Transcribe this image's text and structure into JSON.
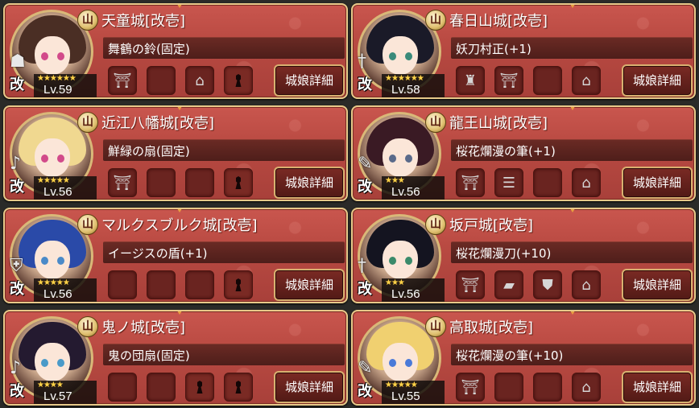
{
  "detail_label": "城娘詳細",
  "kai": "改",
  "mountain": "山",
  "cards": [
    {
      "name": "天童城[改壱]",
      "weapon": "舞鶴の鈴(固定)",
      "stars": "★★★★★★",
      "level": "Lv.59",
      "side_icon": "bell-stack-icon",
      "hair": "#4a2e24",
      "eye": "#d24a8a",
      "slots": [
        "gate-icon",
        "empty",
        "shrine-icon",
        "lock"
      ]
    },
    {
      "name": "春日山城[改壱]",
      "weapon": "妖刀村正(+1)",
      "stars": "★★★★★★",
      "level": "Lv.58",
      "side_icon": "sword-icon",
      "hair": "#1a1a28",
      "eye": "#3a8a7a",
      "slots": [
        "helmet-icon",
        "gate-icon",
        "empty",
        "shrine-icon"
      ]
    },
    {
      "name": "近江八幡城[改壱]",
      "weapon": "鮮緑の扇(固定)",
      "stars": "★★★★★",
      "level": "Lv.56",
      "side_icon": "music-note-icon",
      "hair": "#f0d890",
      "eye": "#d24a8a",
      "slots": [
        "gate-icon",
        "empty",
        "empty",
        "lock"
      ]
    },
    {
      "name": "龍王山城[改壱]",
      "weapon": "桜花爛漫の筆(+1)",
      "stars": "★★★",
      "level": "Lv.56",
      "side_icon": "brush-icon",
      "hair": "#3a1a24",
      "eye": "#5a6a8a",
      "slots": [
        "gate-icon",
        "stamp-icon",
        "empty",
        "shrine-icon"
      ]
    },
    {
      "name": "マルクスブルク城[改壱]",
      "weapon": "イージスの盾(+1)",
      "stars": "★★★★★",
      "level": "Lv.56",
      "side_icon": "shield-icon",
      "hair": "#2a4aa8",
      "eye": "#4a8ac8",
      "slots": [
        "empty",
        "empty",
        "empty",
        "lock"
      ]
    },
    {
      "name": "坂戸城[改壱]",
      "weapon": "桜花爛漫刀(+10)",
      "stars": "★★★",
      "level": "Lv.56",
      "side_icon": "sword-icon",
      "hair": "#141420",
      "eye": "#3a8a6a",
      "slots": [
        "gate-icon",
        "wagon-icon",
        "armor-icon",
        "shrine-icon"
      ]
    },
    {
      "name": "鬼ノ城[改壱]",
      "weapon": "鬼の団扇(固定)",
      "stars": "★★★★",
      "level": "Lv.57",
      "side_icon": "music-note-icon",
      "hair": "#241a30",
      "eye": "#4a9ac8",
      "slots": [
        "empty",
        "empty",
        "lock",
        "lock"
      ]
    },
    {
      "name": "高取城[改壱]",
      "weapon": "桜花爛漫の筆(+10)",
      "stars": "★★★★★",
      "level": "Lv.55",
      "side_icon": "brush-icon",
      "hair": "#f0d070",
      "eye": "#4a7ad8",
      "slots": [
        "gate-icon",
        "empty",
        "empty",
        "shrine-icon"
      ]
    }
  ]
}
